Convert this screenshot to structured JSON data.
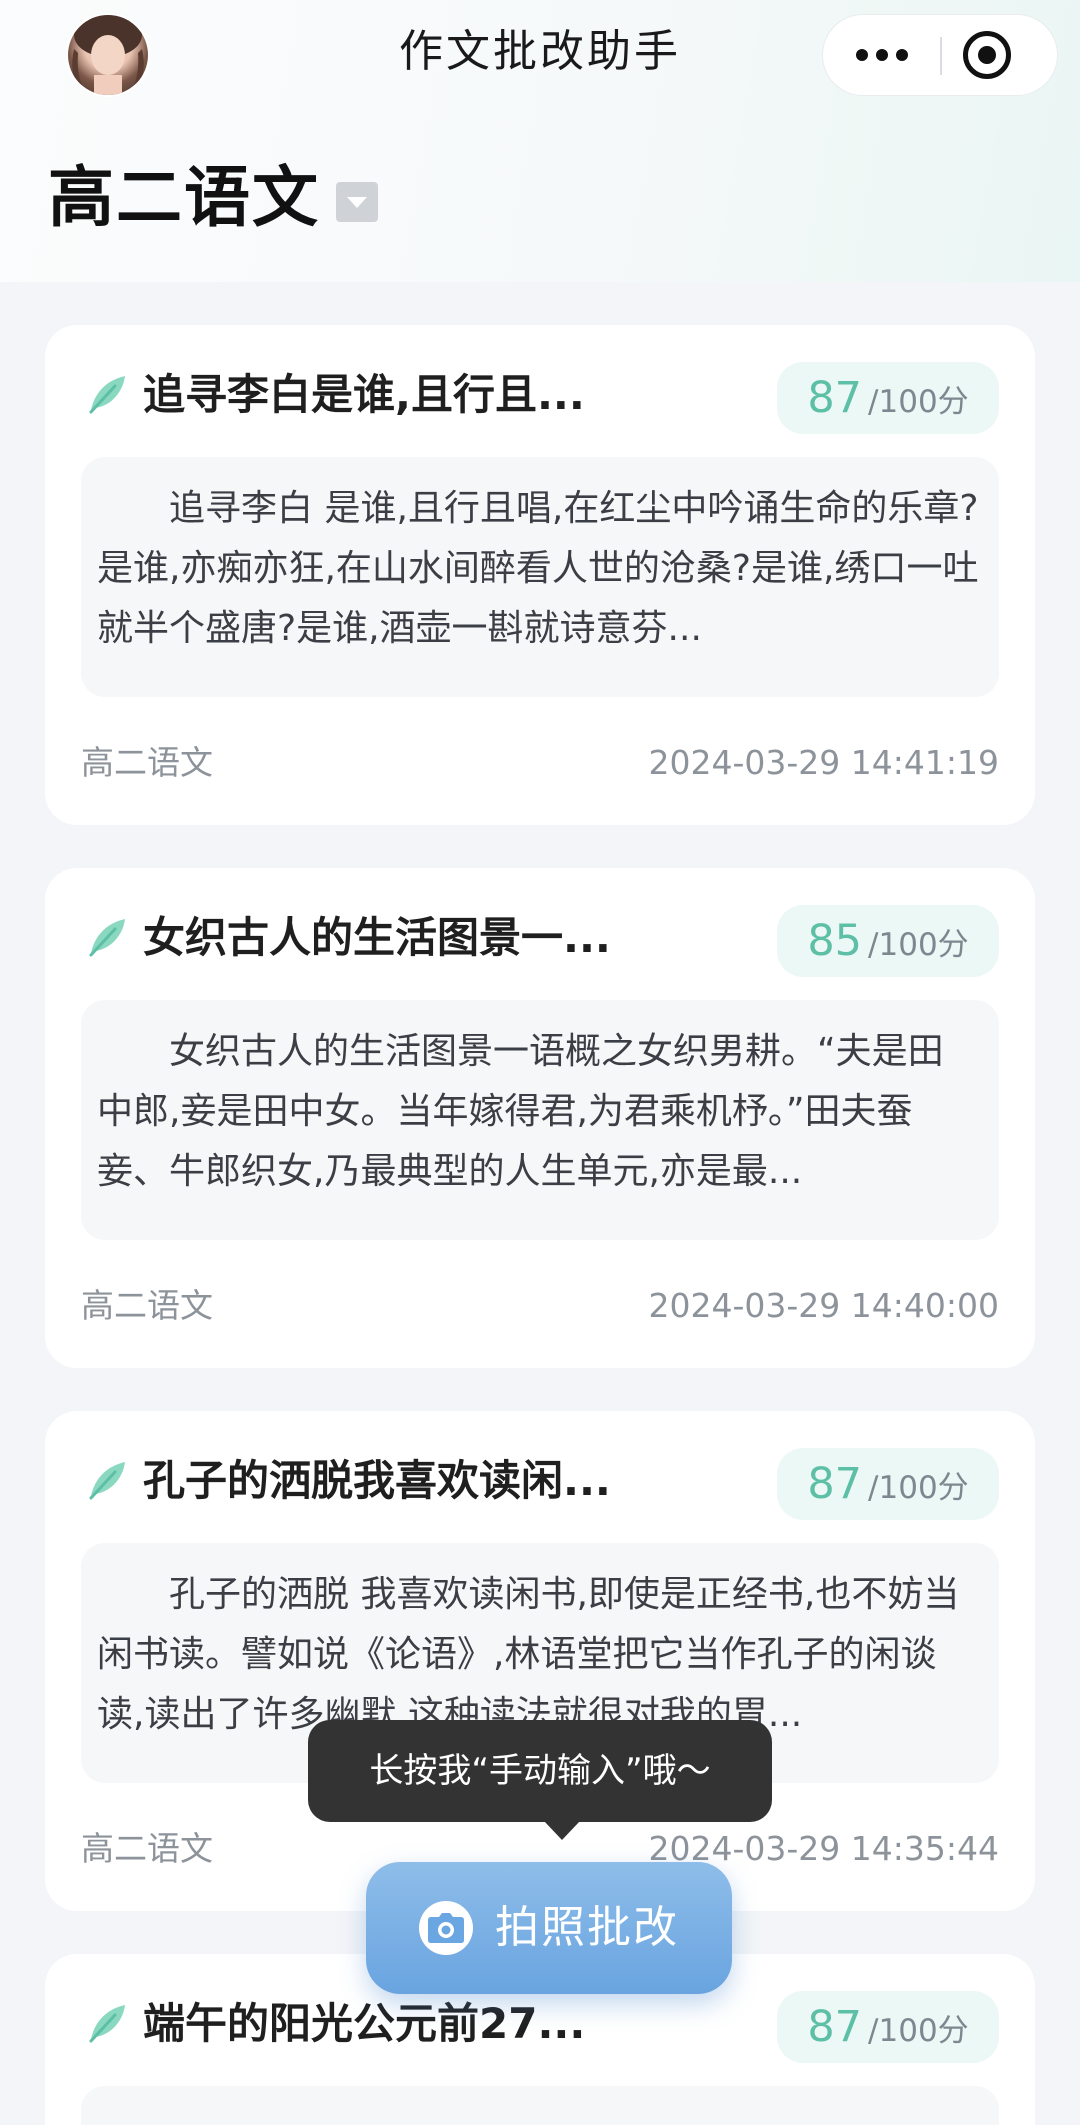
{
  "app": {
    "title": "作文批改助手"
  },
  "header": {
    "subject": "高二语文",
    "colors": {
      "accent_green": "#5cbfa6",
      "button_blue": "#69a4e0"
    }
  },
  "essays": [
    {
      "title": "追寻李白是谁,且行且...",
      "score": "87",
      "score_total": "/100分",
      "excerpt": "追寻李白 是谁,且行且唱,在红尘中吟诵生命的乐章?是谁,亦痴亦狂,在山水间醉看人世的沧桑?是谁,绣口一吐就半个盛唐?是谁,酒壶一斟就诗意芬...",
      "subject": "高二语文",
      "time": "2024-03-29 14:41:19"
    },
    {
      "title": "女织古人的生活图景一...",
      "score": "85",
      "score_total": "/100分",
      "excerpt": "女织古人的生活图景一语概之女织男耕。“夫是田中郎,妾是田中女。当年嫁得君,为君乘机杼。”田夫蚕妾、牛郎织女,乃最典型的人生单元,亦是最...",
      "subject": "高二语文",
      "time": "2024-03-29 14:40:00"
    },
    {
      "title": "孔子的洒脱我喜欢读闲...",
      "score": "87",
      "score_total": "/100分",
      "excerpt": "孔子的洒脱 我喜欢读闲书,即使是正经书,也不妨当闲书读。譬如说《论语》,林语堂把它当作孔子的闲谈读,读出了许多幽默,这种读法就很对我的胃...",
      "subject": "高二语文",
      "time": "2024-03-29 14:35:44"
    },
    {
      "title": "端午的阳光公元前27...",
      "score": "87",
      "score_total": "/100分",
      "excerpt": "",
      "subject": "",
      "time": ""
    }
  ],
  "tooltip": {
    "text": "长按我“手动输入”哦～"
  },
  "photo_button": {
    "label": "拍照批改",
    "icon": "camera-icon"
  }
}
